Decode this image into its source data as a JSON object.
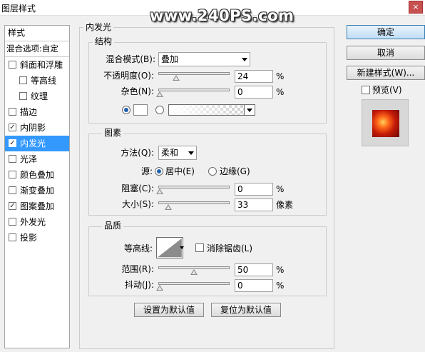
{
  "window": {
    "title": "图层样式",
    "close_glyph": "×"
  },
  "watermark": "www.240PS.com",
  "left_panel": {
    "header": "样式",
    "blend_options": "混合选项:自定",
    "items": [
      {
        "label": "斜面和浮雕",
        "checked": false,
        "indent": false,
        "selected": false
      },
      {
        "label": "等高线",
        "checked": false,
        "indent": true,
        "selected": false
      },
      {
        "label": "纹理",
        "checked": false,
        "indent": true,
        "selected": false
      },
      {
        "label": "描边",
        "checked": false,
        "indent": false,
        "selected": false
      },
      {
        "label": "内阴影",
        "checked": true,
        "indent": false,
        "selected": false
      },
      {
        "label": "内发光",
        "checked": true,
        "indent": false,
        "selected": true
      },
      {
        "label": "光泽",
        "checked": false,
        "indent": false,
        "selected": false
      },
      {
        "label": "颜色叠加",
        "checked": false,
        "indent": false,
        "selected": false
      },
      {
        "label": "渐变叠加",
        "checked": false,
        "indent": false,
        "selected": false
      },
      {
        "label": "图案叠加",
        "checked": true,
        "indent": false,
        "selected": false
      },
      {
        "label": "外发光",
        "checked": false,
        "indent": false,
        "selected": false
      },
      {
        "label": "投影",
        "checked": false,
        "indent": false,
        "selected": false
      }
    ],
    "check_glyph": "✓"
  },
  "panel": {
    "title": "内发光",
    "structure": {
      "legend": "结构",
      "blend_mode_label": "混合模式(B):",
      "blend_mode_value": "叠加",
      "opacity_label": "不透明度(O):",
      "opacity_value": "24",
      "opacity_fraction": 0.24,
      "noise_label": "杂色(N):",
      "noise_value": "0",
      "noise_fraction": 0.0,
      "percent": "%"
    },
    "elements": {
      "legend": "图素",
      "method_label": "方法(Q):",
      "method_value": "柔和",
      "source_label": "源:",
      "source_center": "居中(E)",
      "source_edge": "边缘(G)",
      "choke_label": "阻塞(C):",
      "choke_value": "0",
      "choke_fraction": 0.0,
      "size_label": "大小(S):",
      "size_value": "33",
      "size_fraction": 0.13,
      "percent": "%",
      "pixels": "像素"
    },
    "quality": {
      "legend": "品质",
      "contour_label": "等高线:",
      "antialias_label": "消除锯齿(L)",
      "range_label": "范围(R):",
      "range_value": "50",
      "range_fraction": 0.5,
      "jitter_label": "抖动(J):",
      "jitter_value": "0",
      "jitter_fraction": 0.0,
      "percent": "%"
    },
    "make_default": "设置为默认值",
    "reset_default": "复位为默认值"
  },
  "right": {
    "ok": "确定",
    "cancel": "取消",
    "new_style": "新建样式(W)...",
    "preview_label": "预览(V)",
    "preview_checked": false
  },
  "colors": {
    "selection": "#3399ff",
    "preview_fire": "#c41a08"
  }
}
